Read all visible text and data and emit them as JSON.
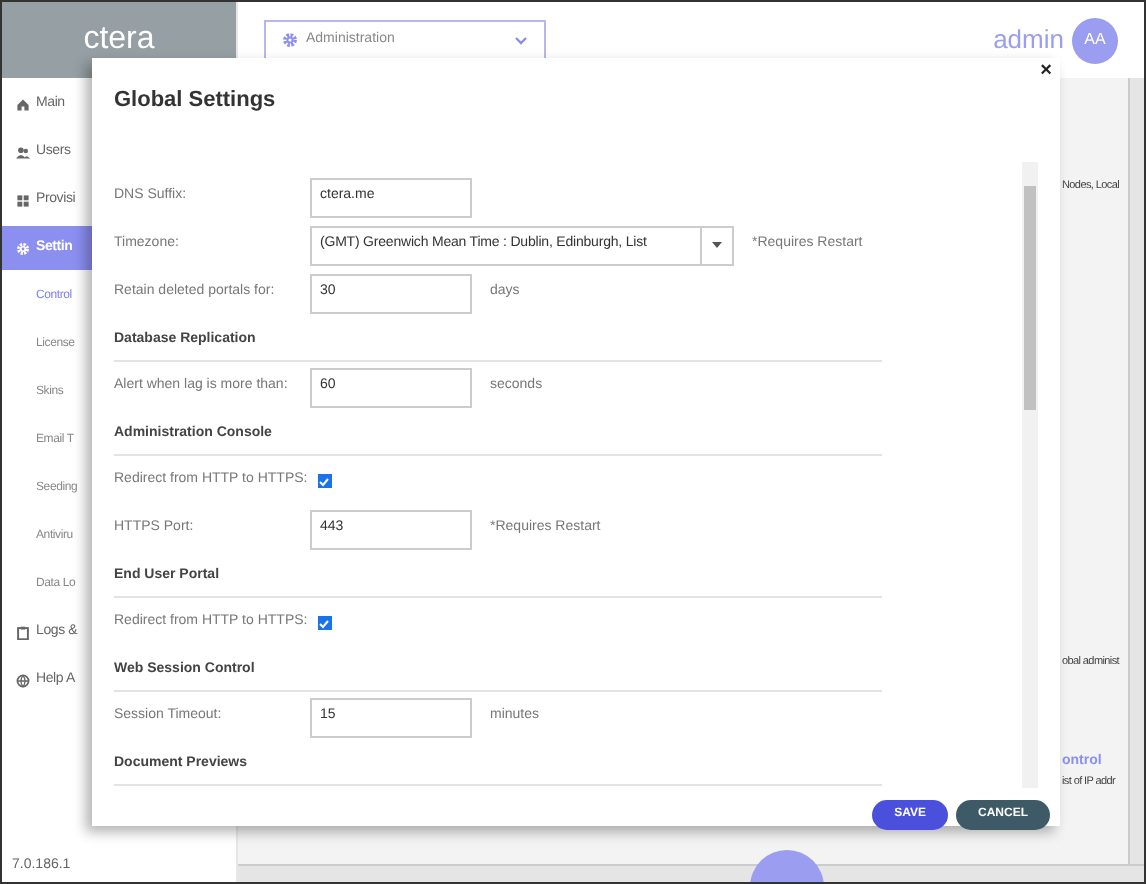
{
  "logo": {
    "text": "ctera"
  },
  "nav": [
    {
      "label": "Main",
      "selected": false
    },
    {
      "label": "Users",
      "selected": false
    },
    {
      "label": "Provisi",
      "selected": false
    },
    {
      "label": "Settin",
      "selected": true,
      "children": [
        {
          "label": "Control",
          "selected": true
        },
        {
          "label": "License",
          "selected": false
        },
        {
          "label": "Skins",
          "selected": false
        },
        {
          "label": "Email T",
          "selected": false
        },
        {
          "label": "Seeding",
          "selected": false
        },
        {
          "label": "Antiviru",
          "selected": false
        },
        {
          "label": "Data Lo",
          "selected": false
        }
      ]
    },
    {
      "label": "Logs &",
      "selected": false
    },
    {
      "label": "Help A",
      "selected": false
    }
  ],
  "version": "7.0.186.1",
  "context_menu": {
    "label": "Administration"
  },
  "user": {
    "name": "admin",
    "initials": "AA"
  },
  "background_texts": [
    {
      "kind": "text",
      "text": "Nodes, Local"
    },
    {
      "kind": "text",
      "text": "obal administ"
    },
    {
      "kind": "link",
      "text": "ontrol"
    },
    {
      "kind": "text",
      "text": "ist of IP addr"
    }
  ],
  "dialog": {
    "title": "Global Settings",
    "close": "×",
    "rows": [
      {
        "kind": "field",
        "label": "DNS Suffix:",
        "value": "ctera.me"
      },
      {
        "kind": "select",
        "label": "Timezone:",
        "value": "(GMT) Greenwich Mean Time : Dublin, Edinburgh, List",
        "note": "*Requires Restart"
      },
      {
        "kind": "field",
        "label": "Retain deleted portals for:",
        "value": "30",
        "note": "days"
      },
      {
        "kind": "section",
        "label": "Database Replication"
      },
      {
        "kind": "field",
        "label": "Alert when lag is more than:",
        "value": "60",
        "note": "seconds"
      },
      {
        "kind": "section",
        "label": "Administration Console"
      },
      {
        "kind": "checkbox",
        "label": "Redirect from HTTP to HTTPS:",
        "checked": true
      },
      {
        "kind": "field",
        "label": "HTTPS Port:",
        "value": "443",
        "note": "*Requires Restart"
      },
      {
        "kind": "section",
        "label": "End User Portal"
      },
      {
        "kind": "checkbox",
        "label": "Redirect from HTTP to HTTPS:",
        "checked": true
      },
      {
        "kind": "section",
        "label": "Web Session Control"
      },
      {
        "kind": "field",
        "label": "Session Timeout:",
        "value": "15",
        "note": "minutes"
      },
      {
        "kind": "section",
        "label": "Document Previews"
      }
    ],
    "buttons": [
      {
        "kind": "primary",
        "label": "SAVE"
      },
      {
        "kind": "secondary",
        "label": "CANCEL"
      }
    ]
  }
}
